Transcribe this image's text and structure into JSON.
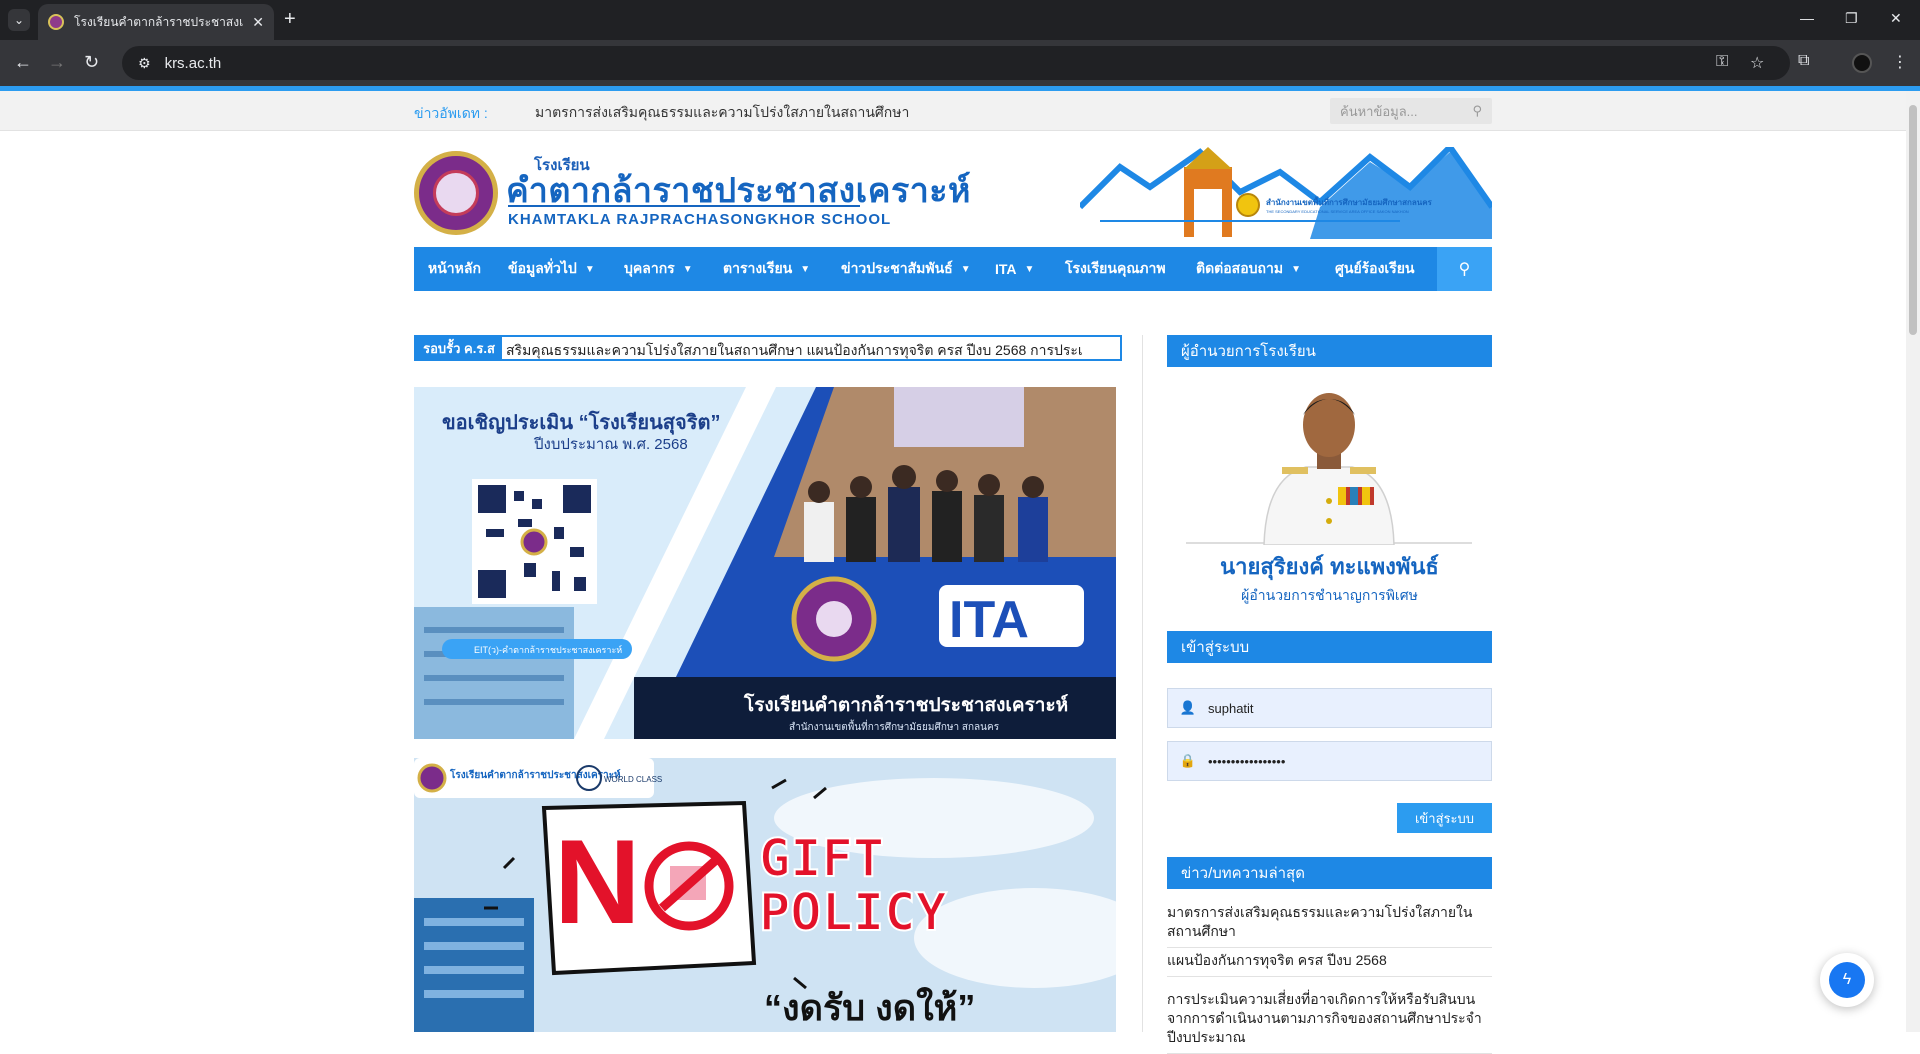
{
  "browser": {
    "tab_title": "โรงเรียนคำตากล้าราชประชาสงเคราะห์",
    "url": "krs.ac.th"
  },
  "topbar": {
    "news_label": "ข่าวอัพเดท :",
    "news_text": "มาตรการส่งเสริมคุณธรรมและความโปร่งใสภายในสถานศึกษา",
    "search_placeholder": "ค้นหาข้อมูล..."
  },
  "header": {
    "school_small": "โรงเรียน",
    "school_th": "คำตากล้าราชประชาสงเคราะห์",
    "school_en": "KHAMTAKLA RAJPRACHASONGKHOR SCHOOL"
  },
  "nav": {
    "items": [
      {
        "label": "หน้าหลัก",
        "dropdown": false
      },
      {
        "label": "ข้อมูลทั่วไป",
        "dropdown": true
      },
      {
        "label": "บุคลากร",
        "dropdown": true
      },
      {
        "label": "ตารางเรียน",
        "dropdown": true
      },
      {
        "label": "ข่าวประชาสัมพันธ์",
        "dropdown": true
      },
      {
        "label": "ITA",
        "dropdown": true
      },
      {
        "label": "โรงเรียนคุณภาพ",
        "dropdown": false
      },
      {
        "label": "ติดต่อสอบถาม",
        "dropdown": true
      },
      {
        "label": "ศูนย์ร้องเรียน",
        "dropdown": false
      }
    ]
  },
  "ticker": {
    "label": "รอบรั้ว ค.ร.ส",
    "text": "สริมคุณธรรมและความโปร่งใสภายในสถานศึกษา      แผนป้องกันการทุจริต ครส ปีงบ 2568      การประเ"
  },
  "banner1": {
    "heading": "ขอเชิญประเมิน “โรงเรียนสุจริต”",
    "sub": "ปีงบประมาณ พ.ศ. 2568",
    "qr_caption": "EIT(ว)-คำตากล้าราชประชาสงเคราะห์",
    "ita": "ITA",
    "school": "โรงเรียนคำตากล้าราชประชาสงเคราะห์",
    "office": "สำนักงานเขตพื้นที่การศึกษามัธยมศึกษา สกลนคร"
  },
  "banner2": {
    "brand_small": "โรงเรียนคำตากล้าราชประชาสงเคราะห์",
    "world_class": "WORLD CLASS",
    "gift": "GIFT",
    "policy": "POLICY",
    "slogan": "“งดรับ งดให้”"
  },
  "banner_top": {
    "office": "สำนักงานเขตพื้นที่การศึกษามัธยมศึกษาสกลนคร",
    "office_en": "THE SECONDARY EDUCATIONAL SERVICE AREA OFFICE SAKON NAKHON"
  },
  "sidebar": {
    "director_head": "ผู้อำนวยการโรงเรียน",
    "director_name": "นายสุริยงค์ ทะแพงพันธ์",
    "director_title": "ผู้อำนวยการชำนาญการพิเศษ",
    "login_head": "เข้าสู่ระบบ",
    "username": "suphatit",
    "password": "•••••••••••••••••",
    "login_button": "เข้าสู่ระบบ",
    "news_head": "ข่าว/บทความล่าสุด",
    "posts": [
      "มาตรการส่งเสริมคุณธรรมและความโปร่งใสภายในสถานศึกษา",
      "แผนป้องกันการทุจริต ครส ปีงบ 2568",
      "การประเมินความเสี่ยงที่อาจเกิดการให้หรือรับสินบนจากการดำเนินงานตามภารกิจของสถานศึกษาประจำปีงบประมาณ"
    ]
  },
  "colors": {
    "primary": "#1e88e5",
    "accent": "#2c9cf0",
    "gift_red": "#e3122a"
  }
}
